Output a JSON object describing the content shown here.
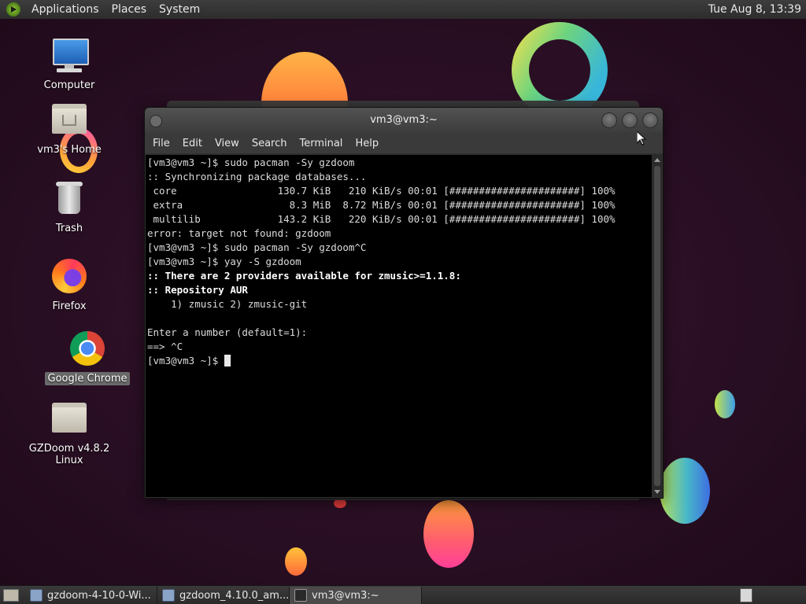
{
  "top_panel": {
    "menus": [
      "Applications",
      "Places",
      "System"
    ],
    "clock": "Tue Aug  8, 13:39"
  },
  "desktop_icons": [
    {
      "label": "Computer",
      "icon": "computer-icon"
    },
    {
      "label": "vm3's Home",
      "icon": "home-folder-icon"
    },
    {
      "label": "Trash",
      "icon": "trash-icon"
    },
    {
      "label": "Firefox",
      "icon": "firefox-icon"
    },
    {
      "label": "Google Chrome",
      "icon": "chrome-icon"
    },
    {
      "label": "GZDoom v4.8.2 Linux",
      "icon": "folder-icon"
    }
  ],
  "terminal": {
    "title": "vm3@vm3:~",
    "menus": [
      "File",
      "Edit",
      "View",
      "Search",
      "Terminal",
      "Help"
    ],
    "lines": [
      {
        "text": "[vm3@vm3 ~]$ sudo pacman -Sy gzdoom",
        "bold": false
      },
      {
        "text": ":: Synchronizing package databases...",
        "bold": false
      },
      {
        "text": " core                 130.7 KiB   210 KiB/s 00:01 [######################] 100%",
        "bold": false
      },
      {
        "text": " extra                  8.3 MiB  8.72 MiB/s 00:01 [######################] 100%",
        "bold": false
      },
      {
        "text": " multilib             143.2 KiB   220 KiB/s 00:01 [######################] 100%",
        "bold": false
      },
      {
        "text": "error: target not found: gzdoom",
        "bold": false
      },
      {
        "text": "[vm3@vm3 ~]$ sudo pacman -Sy gzdoom^C",
        "bold": false
      },
      {
        "text": "[vm3@vm3 ~]$ yay -S gzdoom",
        "bold": false
      },
      {
        "text": ":: There are 2 providers available for zmusic>=1.1.8:",
        "bold": true
      },
      {
        "text": ":: Repository AUR",
        "bold": true
      },
      {
        "text": "    1) zmusic 2) zmusic-git",
        "bold": false
      },
      {
        "text": "",
        "bold": false
      },
      {
        "text": "Enter a number (default=1):",
        "bold": false
      },
      {
        "text": "==> ^C",
        "bold": false
      },
      {
        "text": "[vm3@vm3 ~]$ ",
        "bold": false
      }
    ]
  },
  "taskbar": {
    "tasks": [
      {
        "label": "gzdoom-4-10-0-Wi...",
        "active": false
      },
      {
        "label": "gzdoom_4.10.0_am...",
        "active": false
      },
      {
        "label": "vm3@vm3:~",
        "active": true
      }
    ]
  }
}
